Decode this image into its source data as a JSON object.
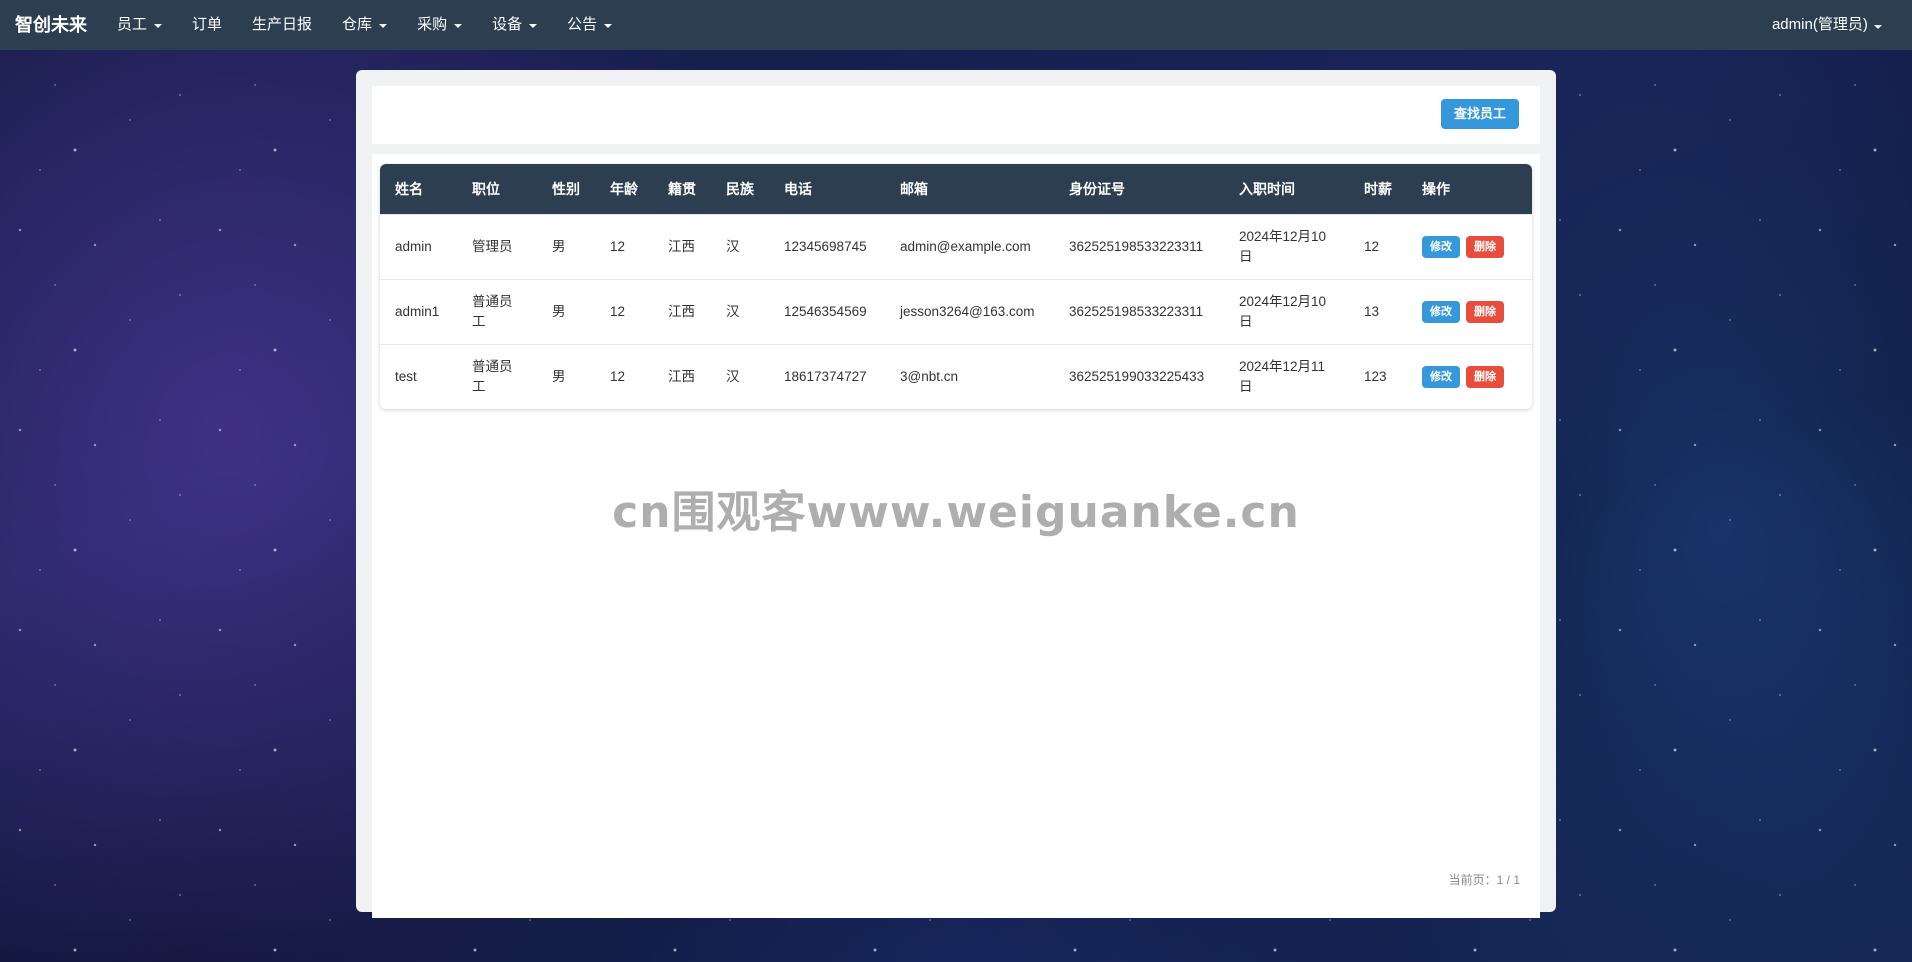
{
  "navbar": {
    "brand": "智创未来",
    "items": [
      {
        "label": "员工",
        "dropdown": true
      },
      {
        "label": "订单",
        "dropdown": false
      },
      {
        "label": "生产日报",
        "dropdown": false
      },
      {
        "label": "仓库",
        "dropdown": true
      },
      {
        "label": "采购",
        "dropdown": true
      },
      {
        "label": "设备",
        "dropdown": true
      },
      {
        "label": "公告",
        "dropdown": true
      }
    ],
    "user": "admin(管理员)",
    "user_dropdown": true
  },
  "toolbar": {
    "find_label": "查找员工"
  },
  "table": {
    "headers": [
      "姓名",
      "职位",
      "性别",
      "年龄",
      "籍贯",
      "民族",
      "电话",
      "邮箱",
      "身份证号",
      "入职时间",
      "时薪",
      "操作"
    ],
    "rows": [
      {
        "name": "admin",
        "position": "管理员",
        "gender": "男",
        "age": "12",
        "origin": "江西",
        "ethnicity": "汉",
        "phone": "12345698745",
        "email": "admin@example.com",
        "id_number": "362525198533223311",
        "hire_date": "2024年12月10日",
        "wage": "12"
      },
      {
        "name": "admin1",
        "position": "普通员工",
        "gender": "男",
        "age": "12",
        "origin": "江西",
        "ethnicity": "汉",
        "phone": "12546354569",
        "email": "jesson3264@163.com",
        "id_number": "362525198533223311",
        "hire_date": "2024年12月10日",
        "wage": "13"
      },
      {
        "name": "test",
        "position": "普通员工",
        "gender": "男",
        "age": "12",
        "origin": "江西",
        "ethnicity": "汉",
        "phone": "18617374727",
        "email": "3@nbt.cn",
        "id_number": "362525199033225433",
        "hire_date": "2024年12月11日",
        "wage": "123"
      }
    ],
    "edit_label": "修改",
    "delete_label": "删除"
  },
  "watermark": "cn围观客www.weiguanke.cn",
  "pagination": {
    "text": "当前页：1 / 1"
  },
  "colors": {
    "navbar": "#2c3e50",
    "primary": "#3498db",
    "danger": "#e74c3c"
  }
}
